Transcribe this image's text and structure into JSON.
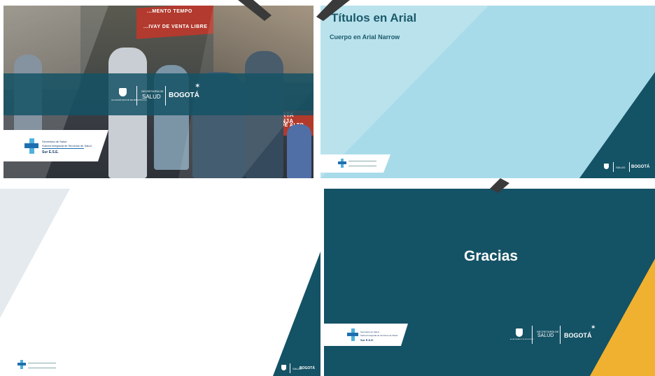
{
  "slides": [
    {
      "background": "photo-scene",
      "sign_lines": [
        "...MENTO TEMPO",
        "...ALERTA NARANJA",
        "...IVAY DE VENTA LIBRE",
        "ZONA DE ALTO C..."
      ],
      "band_color": "#145265",
      "secretaria": "SECRETARÍA DE",
      "salud": "SALUD",
      "bogota": "BOGOTÁ",
      "alcaldia": "ALCALDÍA MAYOR DE BOGOTÁ D.C."
    },
    {
      "title": "Títulos en Arial",
      "body": "Cuerpo en Arial Narrow",
      "background": "#a8dbe9",
      "accent": "#145265",
      "secretaria": "SECRETARÍA DE",
      "salud": "SALUD",
      "bogota": "BOGOTÁ"
    },
    {
      "background": "#ffffff",
      "accent": "#145265",
      "secretaria": "SECRETARÍA DE",
      "salud": "SALUD",
      "bogota": "BOGOTÁ"
    },
    {
      "title": "Gracias",
      "background": "#145265",
      "accent": "#f0b130",
      "secretaria": "SECRETARÍA DE",
      "salud": "SALUD",
      "bogota": "BOGOTÁ",
      "alcaldia": "ALCALDÍA MAYOR DE BOGOTÁ D.C."
    }
  ],
  "subred_logo": {
    "line1": "Secretaría de Salud",
    "line2": "Subred Integrada de Servicios de Salud",
    "line3": "Sur E.S.E."
  },
  "colors": {
    "teal_dark": "#145265",
    "light_blue": "#a8dbe9",
    "cross_blue": "#1f6fb0",
    "cross_light": "#4fb2dc",
    "gold": "#f0b130"
  }
}
